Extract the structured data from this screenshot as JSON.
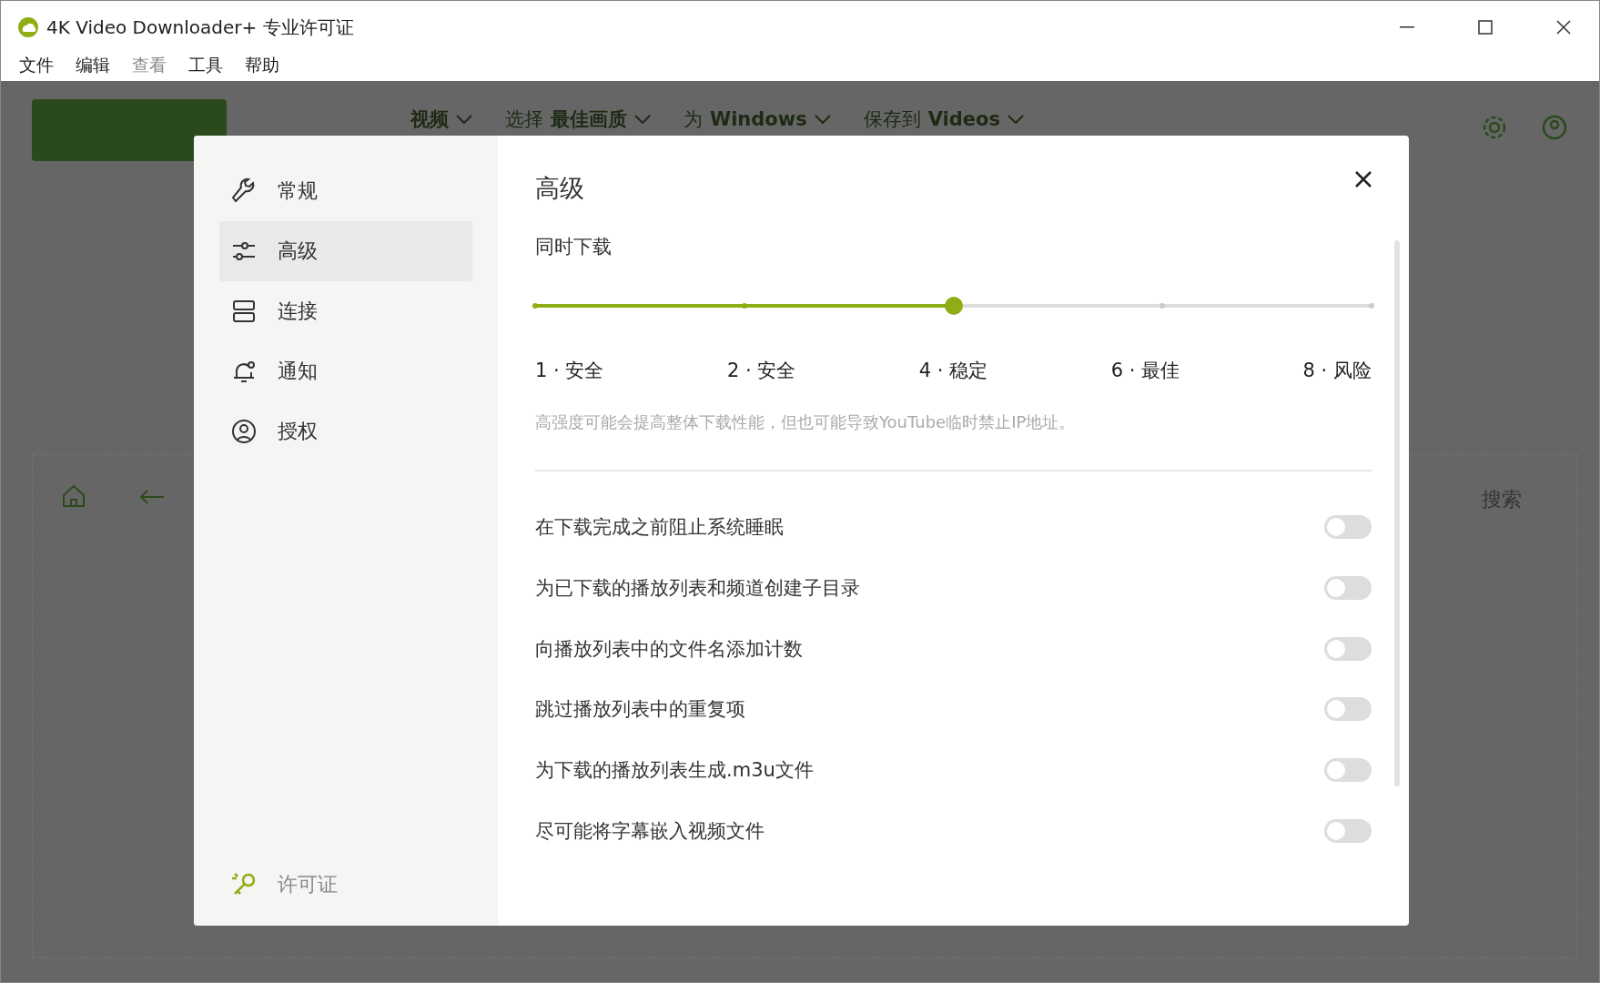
{
  "window": {
    "title": "4K Video Downloader+ 专业许可证"
  },
  "menu": [
    "文件",
    "编辑",
    "查看",
    "工具",
    "帮助"
  ],
  "toolbar": {
    "items": [
      {
        "value": "视频"
      },
      {
        "prefix": "选择",
        "value": "最佳画质"
      },
      {
        "prefix": "为",
        "value": "Windows"
      },
      {
        "prefix": "保存到",
        "value": "Videos"
      }
    ],
    "search": "搜索"
  },
  "settings": {
    "sidebar": [
      {
        "kind": "wrench",
        "label": "常规",
        "selected": false
      },
      {
        "kind": "sliders",
        "label": "高级",
        "selected": true
      },
      {
        "kind": "server",
        "label": "连接",
        "selected": false
      },
      {
        "kind": "bell",
        "label": "通知",
        "selected": false
      },
      {
        "kind": "user",
        "label": "授权",
        "selected": false
      }
    ],
    "license_link": "许可证",
    "title": "高级",
    "concurrent": {
      "label": "同时下载",
      "level": 0.5,
      "ticks": [
        "1 · 安全",
        "2 · 安全",
        "4 · 稳定",
        "6 · 最佳",
        "8 · 风险"
      ],
      "hint": "高强度可能会提高整体下载性能，但也可能导致YouTube临时禁止IP地址。"
    },
    "options": [
      {
        "label": "在下载完成之前阻止系统睡眠",
        "on": false
      },
      {
        "label": "为已下载的播放列表和频道创建子目录",
        "on": false
      },
      {
        "label": "向播放列表中的文件名添加计数",
        "on": false
      },
      {
        "label": "跳过播放列表中的重复项",
        "on": false
      },
      {
        "label": "为下载的播放列表生成.m3u文件",
        "on": false
      },
      {
        "label": "尽可能将字幕嵌入视频文件",
        "on": false
      }
    ]
  }
}
